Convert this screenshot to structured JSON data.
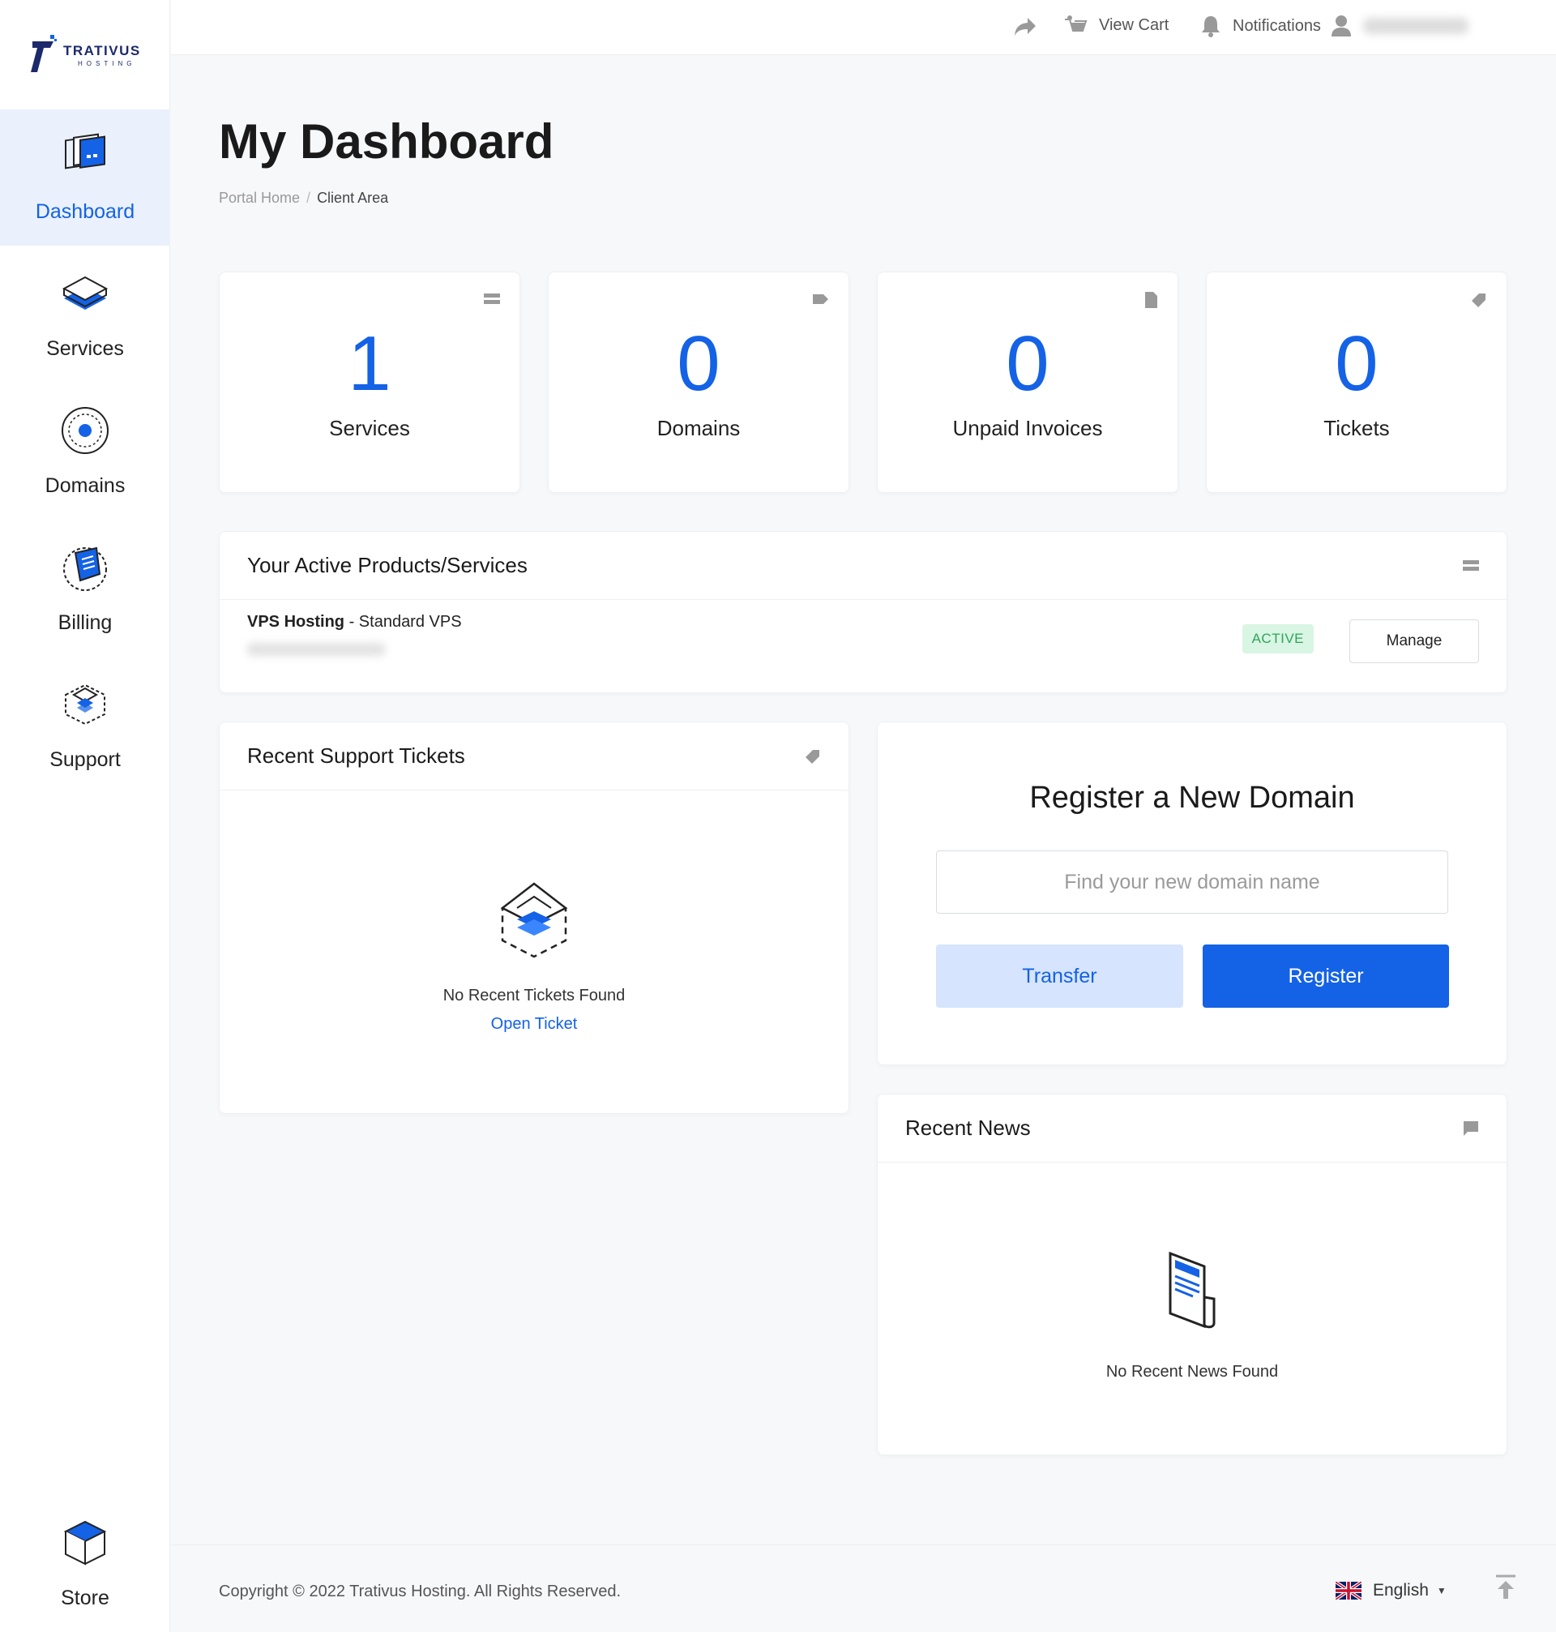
{
  "brand": {
    "name": "TRATIVUS",
    "sub": "HOSTING"
  },
  "sidebar": {
    "items": [
      {
        "label": "Dashboard",
        "icon": "dashboard-icon",
        "active": true
      },
      {
        "label": "Services",
        "icon": "services-icon"
      },
      {
        "label": "Domains",
        "icon": "domains-icon"
      },
      {
        "label": "Billing",
        "icon": "billing-icon"
      },
      {
        "label": "Support",
        "icon": "support-icon"
      },
      {
        "label": "Store",
        "icon": "store-icon"
      }
    ]
  },
  "topbar": {
    "view_cart": "View Cart",
    "notifications": "Notifications"
  },
  "page": {
    "title": "My Dashboard",
    "breadcrumb": {
      "home": "Portal Home",
      "current": "Client Area"
    }
  },
  "stats": [
    {
      "value": "1",
      "label": "Services",
      "icon": "server-icon"
    },
    {
      "value": "0",
      "label": "Domains",
      "icon": "tag-icon"
    },
    {
      "value": "0",
      "label": "Unpaid Invoices",
      "icon": "file-icon"
    },
    {
      "value": "0",
      "label": "Tickets",
      "icon": "ticket-tag-icon"
    }
  ],
  "active_products": {
    "title": "Your Active Products/Services",
    "items": [
      {
        "product": "VPS Hosting",
        "separator": " - ",
        "plan": "Standard VPS",
        "status": "ACTIVE",
        "action": "Manage"
      }
    ]
  },
  "tickets": {
    "title": "Recent Support Tickets",
    "empty_text": "No Recent Tickets Found",
    "link": "Open Ticket"
  },
  "domain": {
    "title": "Register a New Domain",
    "placeholder": "Find your new domain name",
    "transfer": "Transfer",
    "register": "Register"
  },
  "news": {
    "title": "Recent News",
    "empty_text": "No Recent News Found"
  },
  "footer": {
    "copyright": "Copyright © 2022 Trativus Hosting. All Rights Reserved.",
    "language": "English"
  },
  "colors": {
    "accent": "#1462e6",
    "accent_light": "#d6e5fd",
    "active_bg": "#eaf1fc",
    "success_bg": "#d9f5e3",
    "success_text": "#31a35a"
  }
}
